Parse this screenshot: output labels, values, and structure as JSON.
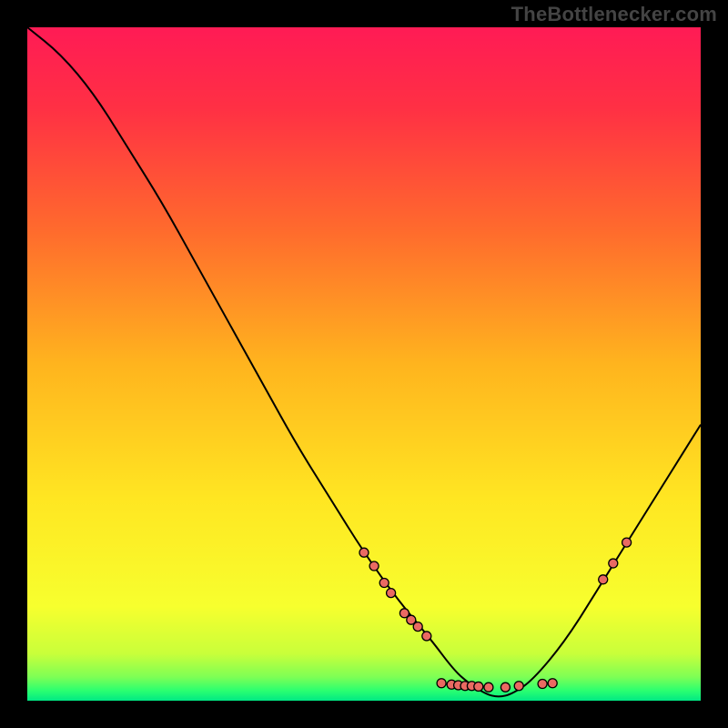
{
  "watermark": "TheBottlenecker.com",
  "chart_data": {
    "type": "line",
    "title": "",
    "xlabel": "",
    "ylabel": "",
    "xlim": [
      0,
      100
    ],
    "ylim": [
      0,
      100
    ],
    "grid": false,
    "legend": false,
    "series": [
      {
        "name": "curve",
        "x": [
          0,
          5,
          10,
          15,
          20,
          25,
          30,
          35,
          40,
          45,
          50,
          55,
          60,
          63,
          65,
          68,
          70,
          72,
          75,
          80,
          85,
          90,
          95,
          100
        ],
        "y": [
          100,
          96,
          90,
          82,
          74,
          65,
          56,
          47,
          38,
          30,
          22,
          15,
          9,
          5,
          3,
          1,
          0.5,
          1,
          3,
          9,
          17,
          25,
          33,
          41
        ],
        "color": "#000000",
        "linewidth": 2
      }
    ],
    "markers": [
      {
        "x": 50,
        "y": 22,
        "r": 5
      },
      {
        "x": 51.5,
        "y": 20,
        "r": 5
      },
      {
        "x": 53,
        "y": 17.5,
        "r": 5
      },
      {
        "x": 54,
        "y": 16,
        "r": 5
      },
      {
        "x": 56,
        "y": 13,
        "r": 5
      },
      {
        "x": 57,
        "y": 12,
        "r": 5
      },
      {
        "x": 58,
        "y": 11,
        "r": 5
      },
      {
        "x": 59.3,
        "y": 9.6,
        "r": 5
      },
      {
        "x": 61.5,
        "y": 2.6,
        "r": 5
      },
      {
        "x": 63,
        "y": 2.4,
        "r": 5
      },
      {
        "x": 64,
        "y": 2.3,
        "r": 5
      },
      {
        "x": 65,
        "y": 2.2,
        "r": 5
      },
      {
        "x": 66,
        "y": 2.2,
        "r": 5
      },
      {
        "x": 67,
        "y": 2.1,
        "r": 5
      },
      {
        "x": 68.5,
        "y": 2.0,
        "r": 5
      },
      {
        "x": 71,
        "y": 2.0,
        "r": 5
      },
      {
        "x": 73,
        "y": 2.2,
        "r": 5
      },
      {
        "x": 76.5,
        "y": 2.5,
        "r": 5
      },
      {
        "x": 78,
        "y": 2.6,
        "r": 5
      },
      {
        "x": 85.5,
        "y": 18,
        "r": 5
      },
      {
        "x": 87,
        "y": 20.4,
        "r": 5
      },
      {
        "x": 89,
        "y": 23.5,
        "r": 5
      }
    ],
    "marker_style": {
      "fill": "#ea6a62",
      "stroke": "#000000",
      "stroke_width": 1.3
    },
    "background_gradient": {
      "stops": [
        {
          "offset": 0.0,
          "color": "#ff1b55"
        },
        {
          "offset": 0.12,
          "color": "#ff3044"
        },
        {
          "offset": 0.3,
          "color": "#ff6a2d"
        },
        {
          "offset": 0.5,
          "color": "#ffb41e"
        },
        {
          "offset": 0.7,
          "color": "#ffe622"
        },
        {
          "offset": 0.86,
          "color": "#f7ff2e"
        },
        {
          "offset": 0.93,
          "color": "#c9ff3a"
        },
        {
          "offset": 0.965,
          "color": "#7dff55"
        },
        {
          "offset": 0.985,
          "color": "#2bff70"
        },
        {
          "offset": 1.0,
          "color": "#00e884"
        }
      ]
    }
  }
}
